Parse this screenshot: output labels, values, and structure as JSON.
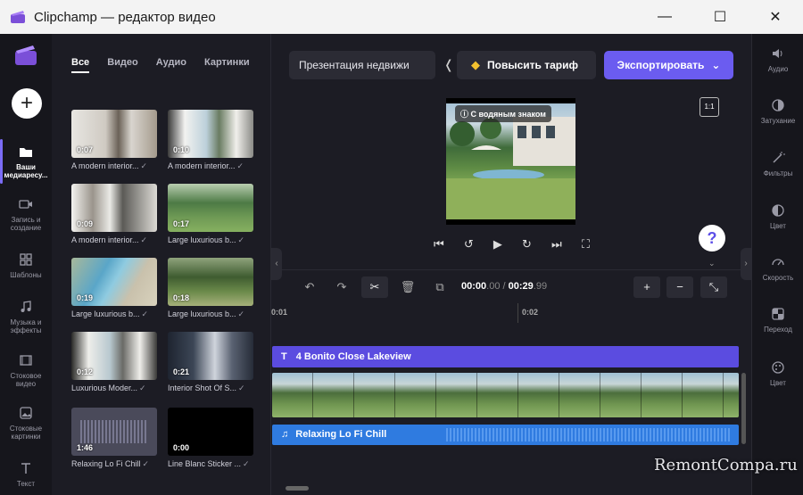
{
  "window": {
    "title": "Clipchamp — редактор видео"
  },
  "left_rail": {
    "add_label": "+",
    "items": [
      {
        "label": "Ваши медиаресу...",
        "icon": "folder-icon"
      },
      {
        "label": "Запись и создание",
        "icon": "camera-icon"
      },
      {
        "label": "Шаблоны",
        "icon": "grid-icon"
      },
      {
        "label": "Музыка и эффекты",
        "icon": "music-icon"
      },
      {
        "label": "Стоковое видео",
        "icon": "film-icon"
      },
      {
        "label": "Стоковые картинки",
        "icon": "image-icon"
      },
      {
        "label": "Текст",
        "icon": "text-icon"
      }
    ]
  },
  "media_tabs": [
    "Все",
    "Видео",
    "Аудио",
    "Картинки"
  ],
  "media": [
    {
      "duration": "0:07",
      "caption": "A modern interior..."
    },
    {
      "duration": "0:10",
      "caption": "A modern interior..."
    },
    {
      "duration": "0:09",
      "caption": "A modern interior..."
    },
    {
      "duration": "0:17",
      "caption": "Large luxurious b..."
    },
    {
      "duration": "0:19",
      "caption": "Large luxurious b..."
    },
    {
      "duration": "0:18",
      "caption": "Large luxurious b..."
    },
    {
      "duration": "0:12",
      "caption": "Luxurious Moder..."
    },
    {
      "duration": "0:21",
      "caption": "Interior Shot Of S..."
    },
    {
      "duration": "1:46",
      "caption": "Relaxing Lo Fi Chill"
    },
    {
      "duration": "0:00",
      "caption": "Line Blanc Sticker ..."
    }
  ],
  "toolbar": {
    "project_name": "Презентация недвижи",
    "upgrade_label": "Повысить тариф",
    "export_label": "Экспортировать"
  },
  "preview": {
    "watermark_label": "С водяным знаком",
    "ratio": "1:1"
  },
  "timeline": {
    "current_time": "00:00",
    "current_frac": ".00",
    "separator": "/",
    "total_time": "00:29",
    "total_frac": ".99",
    "ticks": [
      "0:01",
      "0:02"
    ],
    "text_track": "4 Bonito Close Lakeview",
    "audio_track": "Relaxing Lo Fi Chill"
  },
  "right_rail": [
    {
      "label": "Аудио",
      "icon": "speaker-icon"
    },
    {
      "label": "Затухание",
      "icon": "fade-icon"
    },
    {
      "label": "Фильтры",
      "icon": "wand-icon"
    },
    {
      "label": "Цвет",
      "icon": "contrast-icon"
    },
    {
      "label": "Скорость",
      "icon": "speed-icon"
    },
    {
      "label": "Переход",
      "icon": "transition-icon"
    },
    {
      "label": "Цвет",
      "icon": "palette-icon"
    }
  ],
  "site_watermark": "RemontCompa.ru",
  "colors": {
    "accent": "#6b5cf0",
    "text_track": "#5b4ce0",
    "audio_track": "#2f7be0",
    "gem": "#f3c12f"
  }
}
